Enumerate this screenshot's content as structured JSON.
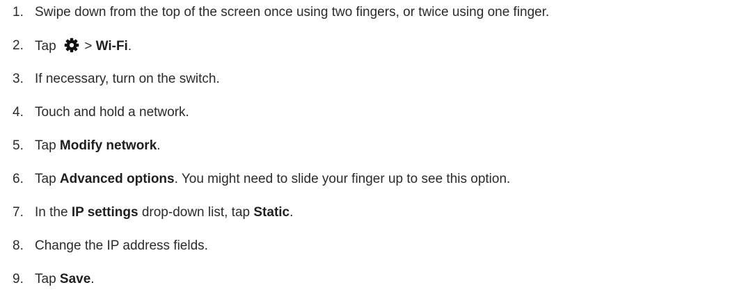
{
  "steps": [
    {
      "num": "1.",
      "parts": [
        {
          "t": "Swipe down from the top of the screen once using two fingers, or twice using one finger."
        }
      ]
    },
    {
      "num": "2.",
      "parts": [
        {
          "t": "Tap "
        },
        {
          "icon": "settings-gear-icon"
        },
        {
          "t": " > "
        },
        {
          "t": "Wi-Fi",
          "b": true
        },
        {
          "t": "."
        }
      ]
    },
    {
      "num": "3.",
      "parts": [
        {
          "t": "If necessary, turn on the switch."
        }
      ]
    },
    {
      "num": "4.",
      "parts": [
        {
          "t": "Touch and hold a network."
        }
      ]
    },
    {
      "num": "5.",
      "parts": [
        {
          "t": "Tap "
        },
        {
          "t": "Modify network",
          "b": true
        },
        {
          "t": "."
        }
      ]
    },
    {
      "num": "6.",
      "parts": [
        {
          "t": "Tap "
        },
        {
          "t": "Advanced options",
          "b": true
        },
        {
          "t": ". You might need to slide your finger up to see this option."
        }
      ]
    },
    {
      "num": "7.",
      "parts": [
        {
          "t": "In the "
        },
        {
          "t": "IP settings",
          "b": true
        },
        {
          "t": " drop-down list, tap "
        },
        {
          "t": "Static",
          "b": true
        },
        {
          "t": "."
        }
      ]
    },
    {
      "num": "8.",
      "parts": [
        {
          "t": "Change the IP address fields."
        }
      ]
    },
    {
      "num": "9.",
      "parts": [
        {
          "t": "Tap "
        },
        {
          "t": "Save",
          "b": true
        },
        {
          "t": "."
        }
      ]
    }
  ]
}
